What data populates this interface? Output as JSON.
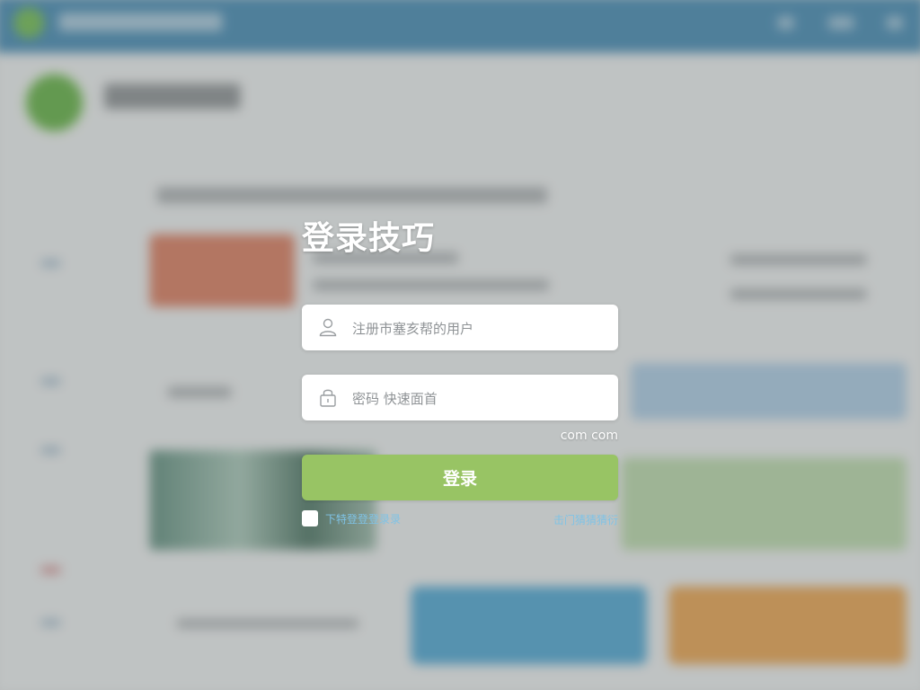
{
  "login": {
    "title": "登录技巧",
    "username": {
      "placeholder": "注册市塞亥帮的用户",
      "icon": "user-icon"
    },
    "password": {
      "placeholder": "密码 快速面首",
      "icon": "lock-icon"
    },
    "domain_hint": "com com",
    "submit_label": "登录",
    "remember_label": "下特登登登录录",
    "forgot_label": "击门猜猜猜衍"
  },
  "colors": {
    "accent_green": "#98c464",
    "link_blue": "#7fc3e6",
    "header_blue": "#3f86b0"
  }
}
